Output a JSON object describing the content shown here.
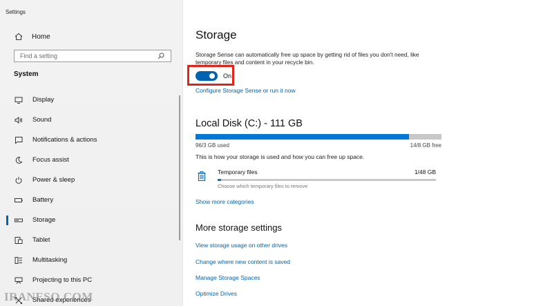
{
  "app": {
    "title": "Settings"
  },
  "sidebar": {
    "home_label": "Home",
    "search_placeholder": "Find a setting",
    "section_label": "System",
    "items": [
      {
        "label": "Display",
        "icon": "display-icon"
      },
      {
        "label": "Sound",
        "icon": "sound-icon"
      },
      {
        "label": "Notifications & actions",
        "icon": "notifications-icon"
      },
      {
        "label": "Focus assist",
        "icon": "moon-icon"
      },
      {
        "label": "Power & sleep",
        "icon": "power-icon"
      },
      {
        "label": "Battery",
        "icon": "battery-icon"
      },
      {
        "label": "Storage",
        "icon": "storage-icon",
        "active": true
      },
      {
        "label": "Tablet",
        "icon": "tablet-icon"
      },
      {
        "label": "Multitasking",
        "icon": "multitasking-icon"
      },
      {
        "label": "Projecting to this PC",
        "icon": "projecting-icon"
      },
      {
        "label": "Shared experiences",
        "icon": "shared-experiences-icon"
      }
    ]
  },
  "watermark": "IRANESO.COM",
  "main": {
    "title": "Storage",
    "description": "Storage Sense can automatically free up space by getting rid of files you don't need, like temporary files and content in your recycle bin.",
    "toggle": {
      "state_label": "On",
      "on": true
    },
    "configure_link": "Configure Storage Sense or run it now",
    "disk": {
      "title": "Local Disk (C:) - 111 GB",
      "used_label": "96/3 GB used",
      "free_label": "14/8 GB free",
      "used_fraction": 0.867,
      "info": "This is how your storage is used and how you can free up space."
    },
    "temp": {
      "name": "Temporary files",
      "size": "1/48 GB",
      "description": "Choose which temporary files to remove",
      "used_fraction": 0.013
    },
    "show_more": "Show more categories",
    "more_title": "More storage settings",
    "links": [
      "View storage usage on other drives",
      "Change where new content is saved",
      "Manage Storage Spaces",
      "Optimize Drives"
    ]
  },
  "colors": {
    "accent": "#0063b1",
    "highlight_box": "#e2231a",
    "bar_background": "#c8c8c8"
  }
}
